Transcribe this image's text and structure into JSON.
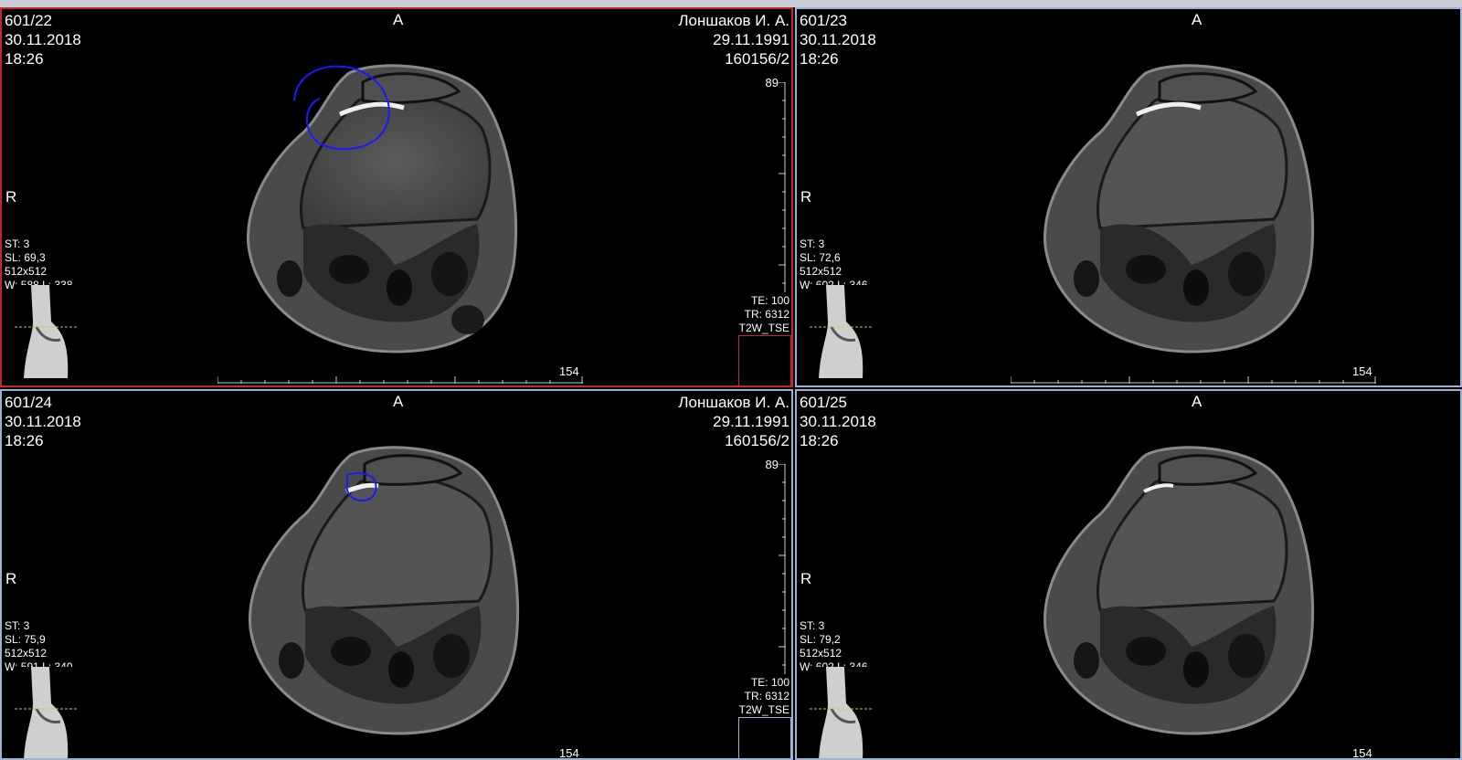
{
  "viewports": [
    {
      "id": "tl",
      "series_image": "601/22",
      "date": "30.11.2018",
      "time": "18:26",
      "orient_top": "A",
      "orient_left": "R",
      "patient_name": "Лоншаков И. А.",
      "patient_dob": "29.11.1991",
      "patient_id": "160156/2",
      "st": "ST: 3",
      "sl": "SL: 69,3",
      "matrix": "512x512",
      "window": "W: 588 L: 338",
      "te": "TE: 100",
      "tr": "TR: 6312",
      "sequence": "T2W_TSE",
      "ruler_h_label": "154",
      "ruler_v_label": "89",
      "active": true,
      "annotation": "large-circle"
    },
    {
      "id": "tr",
      "series_image": "601/23",
      "date": "30.11.2018",
      "time": "18:26",
      "orient_top": "A",
      "orient_left": "R",
      "st": "ST: 3",
      "sl": "SL: 72,6",
      "matrix": "512x512",
      "window": "W: 602 L: 346",
      "ruler_h_label": "154"
    },
    {
      "id": "bl",
      "series_image": "601/24",
      "date": "30.11.2018",
      "time": "18:26",
      "orient_top": "A",
      "orient_left": "R",
      "patient_name": "Лоншаков И. А.",
      "patient_dob": "29.11.1991",
      "patient_id": "160156/2",
      "st": "ST: 3",
      "sl": "SL: 75,9",
      "matrix": "512x512",
      "window": "W: 591 L: 340",
      "te": "TE: 100",
      "tr": "TR: 6312",
      "sequence": "T2W_TSE",
      "ruler_h_label": "154",
      "ruler_v_label": "89",
      "annotation": "small-circle"
    },
    {
      "id": "br",
      "series_image": "601/25",
      "date": "30.11.2018",
      "time": "18:26",
      "orient_top": "A",
      "orient_left": "R",
      "st": "ST: 3",
      "sl": "SL: 79,2",
      "matrix": "512x512",
      "window": "W: 602 L: 346",
      "ruler_h_label": "154"
    }
  ],
  "colors": {
    "active_border": "#c1272d",
    "inactive_border": "#9fb0d8",
    "annotation": "#1a1aff",
    "scout_line": "#b5d63a"
  }
}
